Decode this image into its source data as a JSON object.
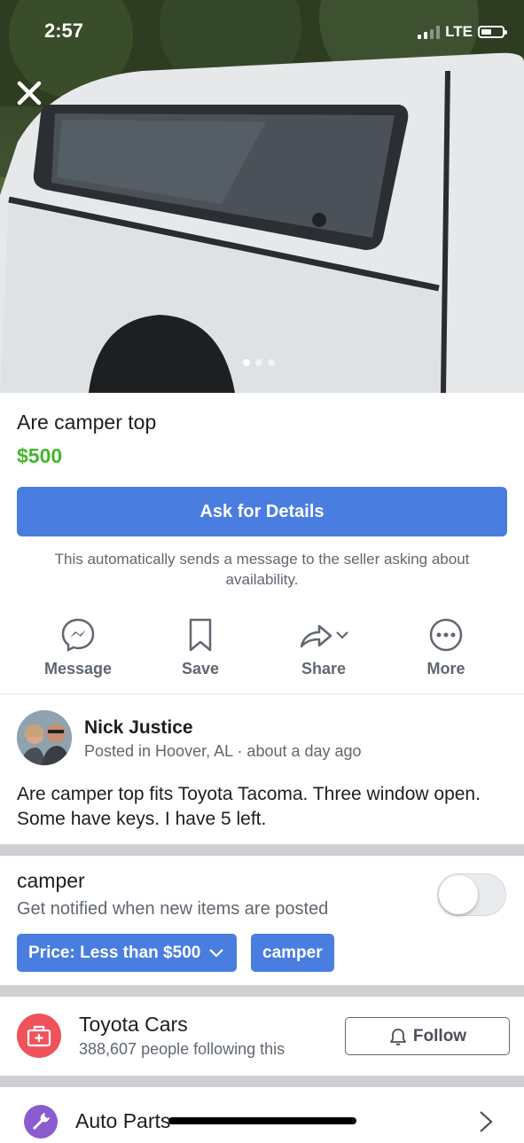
{
  "status_bar": {
    "time": "2:57",
    "network": "LTE"
  },
  "hero": {
    "photo_count": 3,
    "active_photo": 1,
    "close_icon": "close-icon"
  },
  "listing": {
    "title": "Are camper top",
    "price": "$500",
    "ask_button": "Ask for Details",
    "helper_text": "This automatically sends a message to the seller asking about availability."
  },
  "actions": [
    {
      "label": "Message",
      "icon": "messenger-icon"
    },
    {
      "label": "Save",
      "icon": "bookmark-icon"
    },
    {
      "label": "Share",
      "icon": "share-icon"
    },
    {
      "label": "More",
      "icon": "more-icon"
    }
  ],
  "seller": {
    "name": "Nick Justice",
    "meta": "Posted in Hoover, AL · about a day ago"
  },
  "description": "Are camper top fits Toyota Tacoma. Three window open. Some have keys.  I have 5 left.",
  "saved_search": {
    "title": "camper",
    "subtitle": "Get notified when new items are posted",
    "toggle_on": false,
    "chips": [
      "Price: Less than $500",
      "camper"
    ]
  },
  "group": {
    "name": "Toyota Cars",
    "followers": "388,607 people following this",
    "follow_label": "Follow"
  },
  "category": {
    "name": "Auto Parts"
  },
  "colors": {
    "accent": "#4a7de0",
    "price": "#42b72a",
    "secondary_text": "#606770",
    "group_icon": "#f0525c",
    "category_icon": "#8a5cd0"
  }
}
